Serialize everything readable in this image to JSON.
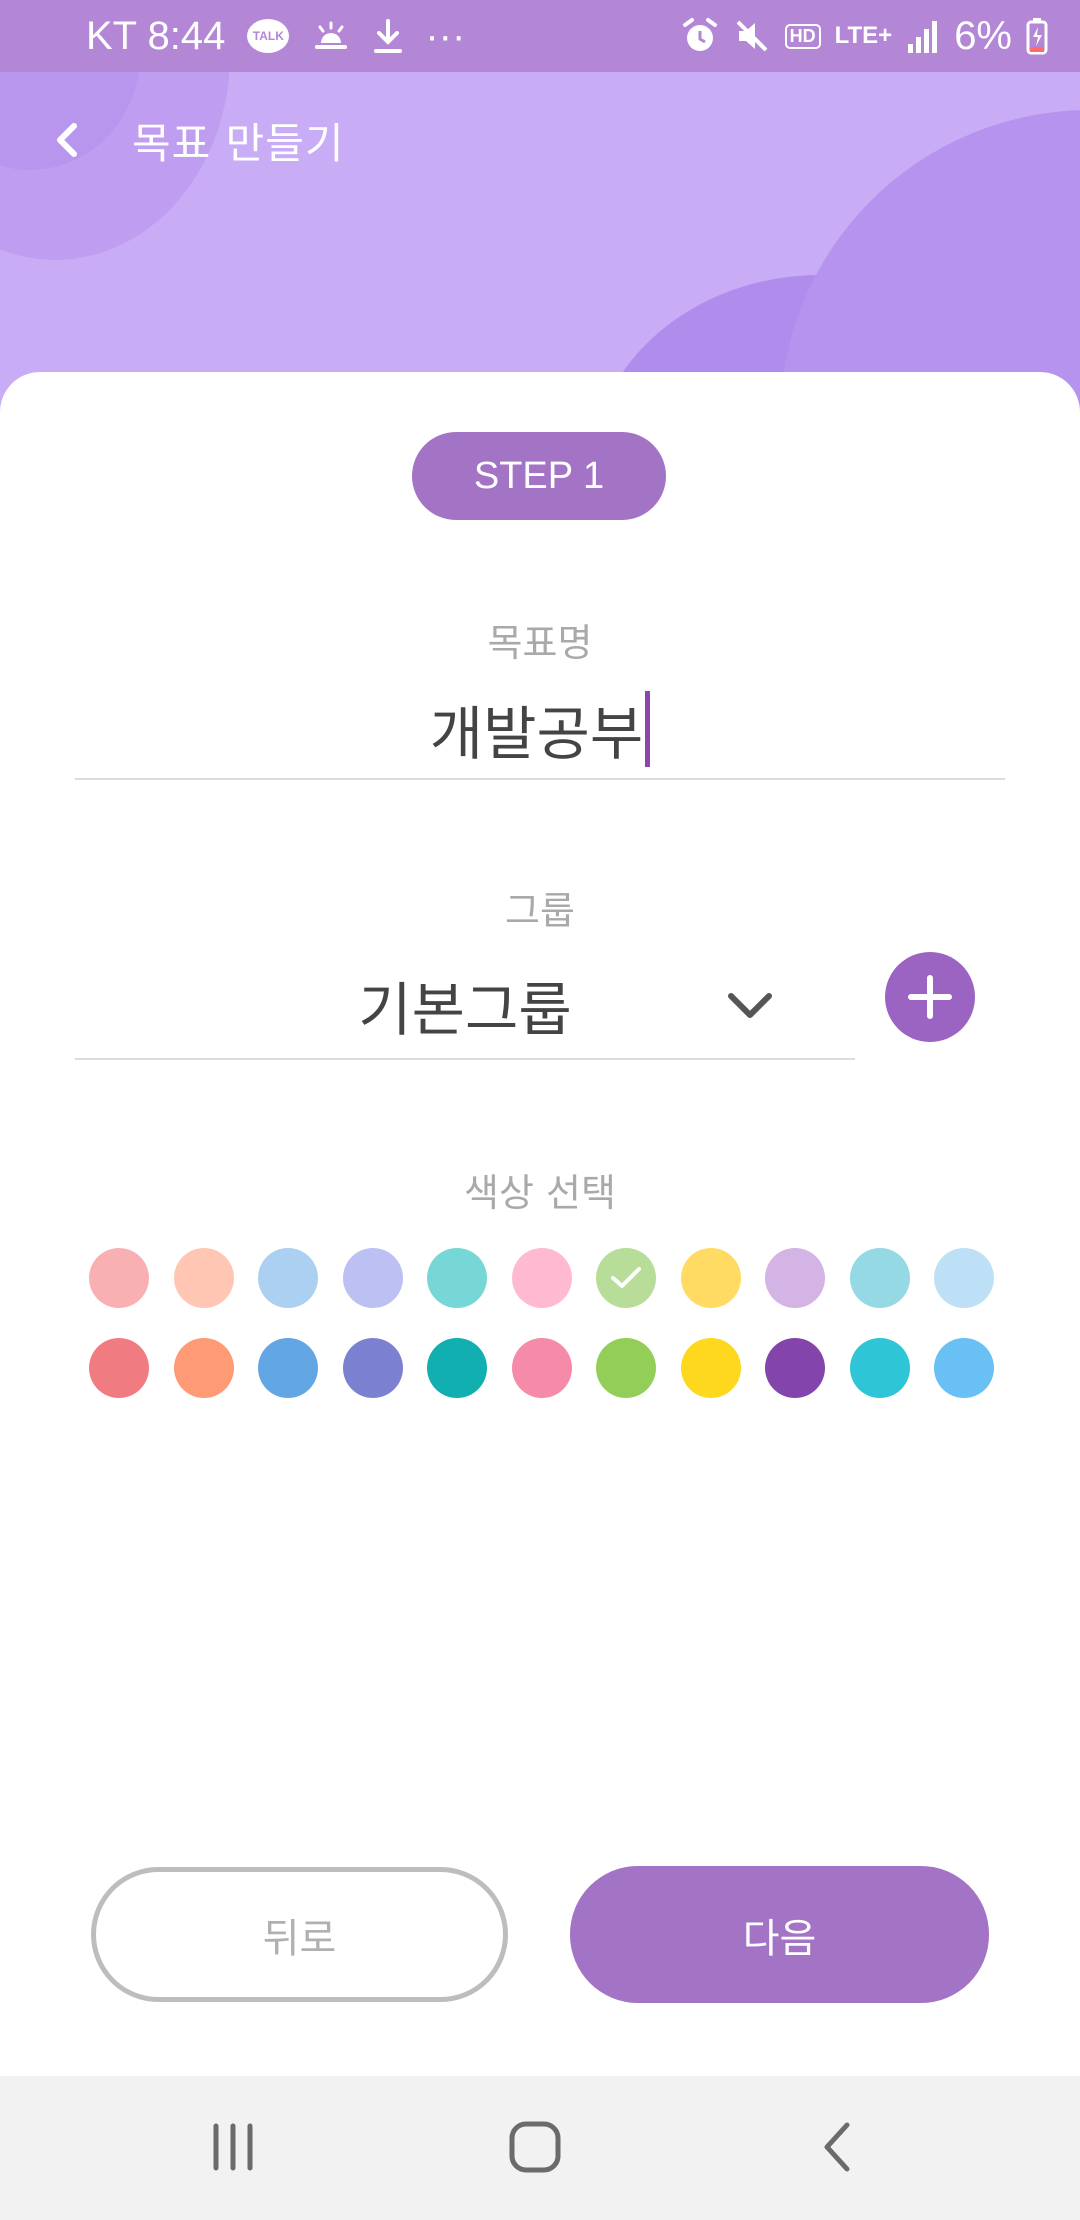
{
  "status_bar": {
    "carrier_time": "KT 8:44",
    "talk_label": "TALK",
    "more": "···",
    "hd_label": "HD",
    "network_label": "LTE+",
    "battery": "6%",
    "icons": [
      "kakaotalk-icon",
      "weather-icon",
      "download-icon",
      "more-icon",
      "alarm-icon",
      "mute-icon",
      "hd-voice-icon",
      "lte-icon",
      "signal-icon",
      "battery-icon"
    ]
  },
  "header": {
    "title": "목표 만들기",
    "back_icon": "chevron-left-icon"
  },
  "step": {
    "label": "STEP 1"
  },
  "goal": {
    "label": "목표명",
    "value": "개발공부"
  },
  "group": {
    "label": "그룹",
    "value": "기본그룹",
    "dropdown_icon": "chevron-down-icon",
    "add_icon": "plus-icon"
  },
  "color": {
    "label": "색상 선택",
    "selected": "#b7dd98",
    "rows": [
      [
        "#f9b0b3",
        "#ffc7b3",
        "#acd0f2",
        "#bcc0f2",
        "#77d6d6",
        "#ffb9d1",
        "#b7dd98",
        "#ffdb63",
        "#d4b3e5",
        "#94d9e3",
        "#bee0f6"
      ],
      [
        "#f07b80",
        "#ff9a76",
        "#63a6e4",
        "#7b80d1",
        "#12afb0",
        "#f58aa9",
        "#93cf58",
        "#fdd81e",
        "#8344ab",
        "#2ec5d7",
        "#69c0f5"
      ]
    ]
  },
  "buttons": {
    "back_label": "뒤로",
    "next_label": "다음"
  },
  "nav_bar": {
    "icons": [
      "recent-apps-icon",
      "home-icon",
      "back-icon"
    ]
  },
  "theme": {
    "accent": "#a373c6",
    "header_bg": "#c9acf6",
    "status_bg": "#b386d6"
  }
}
